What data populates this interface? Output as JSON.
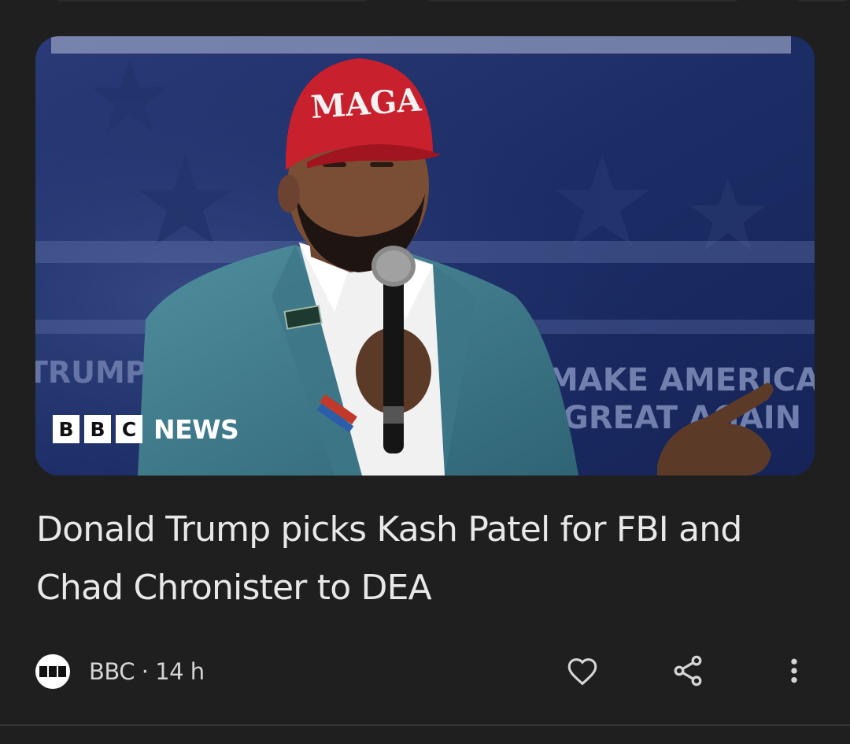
{
  "article": {
    "image_alt": "Kash Patel speaking at a rally",
    "hero_overlay": {
      "brand_letters": [
        "B",
        "B",
        "C"
      ],
      "brand_word": "NEWS",
      "hat_text": "MAGA",
      "backdrop_text_1": "MAKE AMERICA",
      "backdrop_text_2": "GREAT AGAIN",
      "backdrop_text_left": "TRUMP"
    },
    "headline": "Donald Trump picks Kash Patel for FBI and Chad Chronister to DEA",
    "source": {
      "name": "BBC",
      "separator": " · ",
      "age": "14 h"
    },
    "actions": {
      "like_icon": "heart-outline-icon",
      "share_icon": "share-icon",
      "more_icon": "more-vertical-icon"
    }
  },
  "colors": {
    "background": "#1f1f1f",
    "text_primary": "#e8e8e8",
    "text_secondary": "#d5d5d5",
    "hat_red": "#c8202c"
  }
}
